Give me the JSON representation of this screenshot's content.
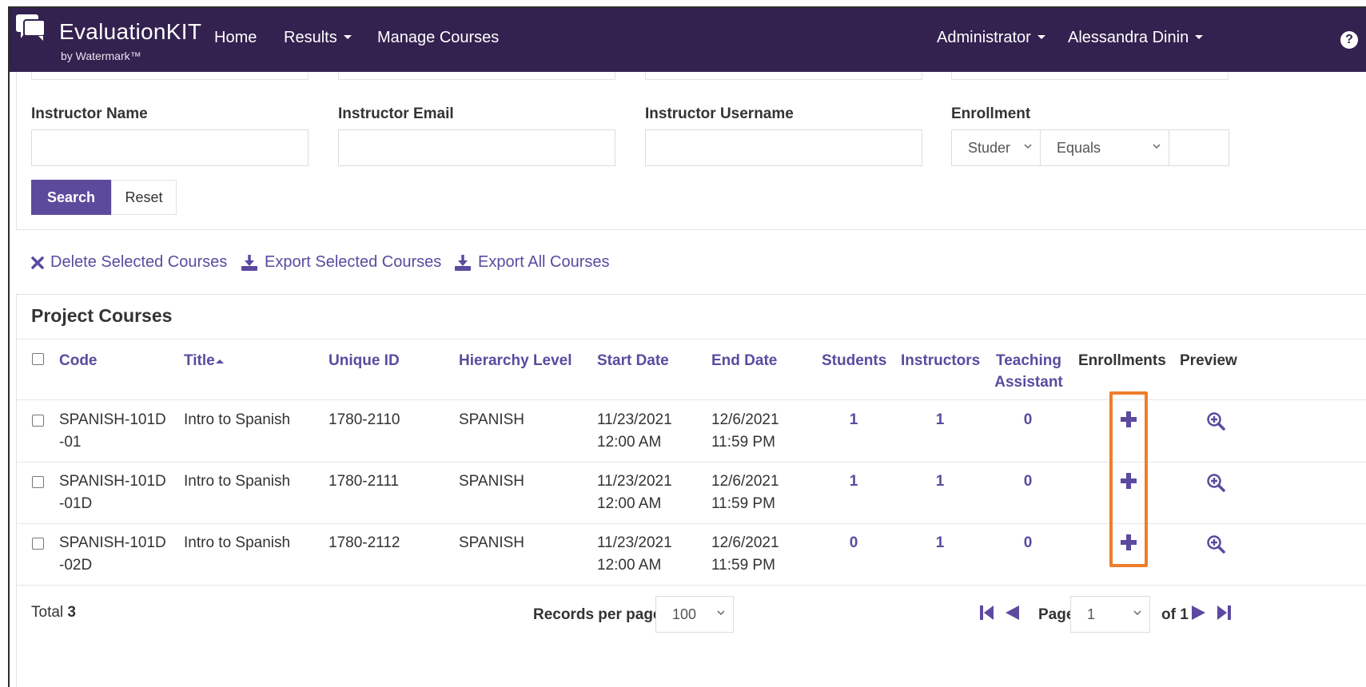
{
  "brand": {
    "name": "EvaluationKIT",
    "sub": "by Watermark™"
  },
  "nav": {
    "home": "Home",
    "results": "Results",
    "manage_courses": "Manage Courses",
    "role": "Administrator",
    "user": "Alessandra Dinin",
    "help": "?"
  },
  "search": {
    "instructor_name_label": "Instructor Name",
    "instructor_email_label": "Instructor Email",
    "instructor_username_label": "Instructor Username",
    "enrollment_label": "Enrollment",
    "enrollment_type": "Studer",
    "enrollment_operator": "Equals",
    "search_button": "Search",
    "reset_button": "Reset"
  },
  "actions": {
    "delete_selected": "Delete Selected Courses",
    "export_selected": "Export Selected Courses",
    "export_all": "Export All Courses"
  },
  "table": {
    "title": "Project Courses",
    "headers": {
      "code": "Code",
      "title": "Title",
      "unique_id": "Unique ID",
      "hierarchy": "Hierarchy Level",
      "start": "Start Date",
      "end": "End Date",
      "students": "Students",
      "instructors": "Instructors",
      "ta_line1": "Teaching",
      "ta_line2": "Assistant",
      "enrollments": "Enrollments",
      "preview": "Preview"
    },
    "rows": [
      {
        "code1": "SPANISH-101D",
        "code2": "-01",
        "title": "Intro to Spanish",
        "unique_id": "1780-2110",
        "hierarchy": "SPANISH",
        "start1": "11/23/2021",
        "start2": "12:00 AM",
        "end1": "12/6/2021",
        "end2": "11:59 PM",
        "students": "1",
        "instructors": "1",
        "ta": "0"
      },
      {
        "code1": "SPANISH-101D",
        "code2": "-01D",
        "title": "Intro to Spanish",
        "unique_id": "1780-2111",
        "hierarchy": "SPANISH",
        "start1": "11/23/2021",
        "start2": "12:00 AM",
        "end1": "12/6/2021",
        "end2": "11:59 PM",
        "students": "1",
        "instructors": "1",
        "ta": "0"
      },
      {
        "code1": "SPANISH-101D",
        "code2": "-02D",
        "title": "Intro to Spanish",
        "unique_id": "1780-2112",
        "hierarchy": "SPANISH",
        "start1": "11/23/2021",
        "start2": "12:00 AM",
        "end1": "12/6/2021",
        "end2": "11:59 PM",
        "students": "0",
        "instructors": "1",
        "ta": "0"
      }
    ]
  },
  "footer": {
    "total_label": "Total",
    "total_value": "3",
    "records_per_page_label": "Records per page",
    "records_per_page": "100",
    "page_label": "Page",
    "page_value": "1",
    "of_label": "of 1"
  },
  "colors": {
    "nav_bg": "#33214f",
    "accent": "#5b4a9f",
    "highlight": "#ef7d2c"
  }
}
